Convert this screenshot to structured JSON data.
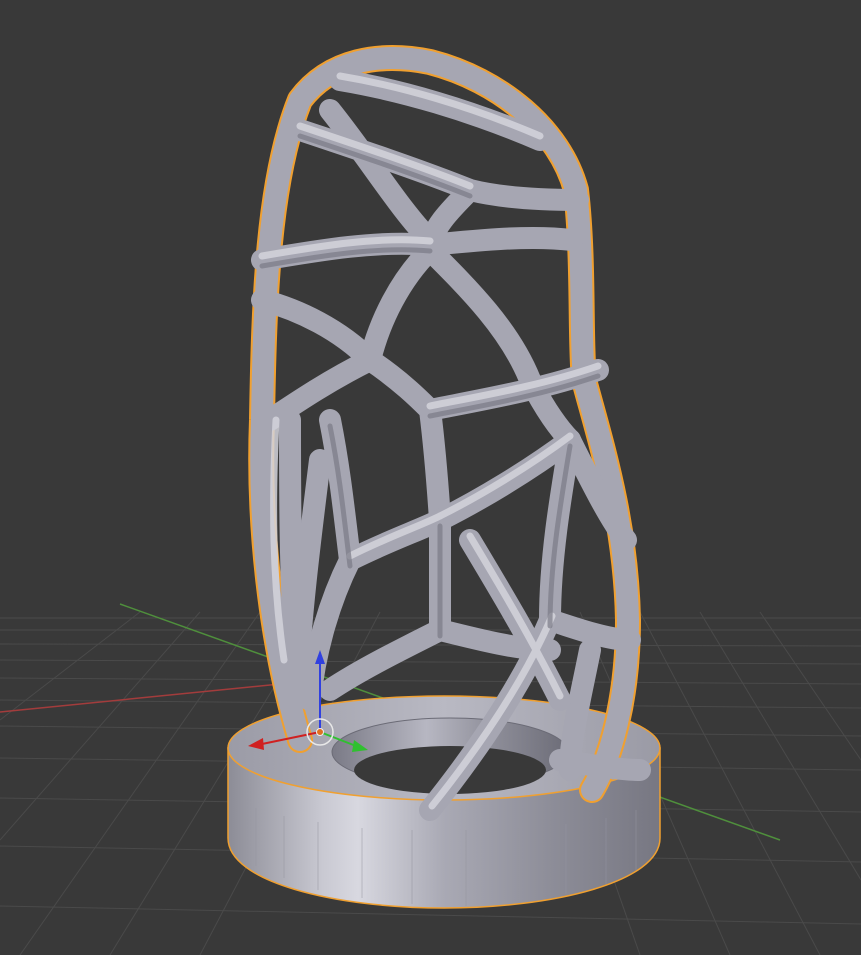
{
  "app": {
    "name": "3D viewport",
    "view": "perspective",
    "background_color": "#393939"
  },
  "scene": {
    "grid": {
      "visible": true,
      "line_color": "#4a4a4a",
      "x_axis_color": "#a33c3c",
      "y_axis_color": "#4f8f3c"
    },
    "selected_object": {
      "type": "mesh",
      "shape": "voronoi lattice vase on a ring base",
      "material_color": "#a6a6b2",
      "selection_outline_color": "#f0a030"
    },
    "transform_gizmo": {
      "x_axis_color": "#d02020",
      "y_axis_color": "#30c030",
      "z_axis_color": "#3040e0",
      "origin_color": "#e07020"
    }
  }
}
